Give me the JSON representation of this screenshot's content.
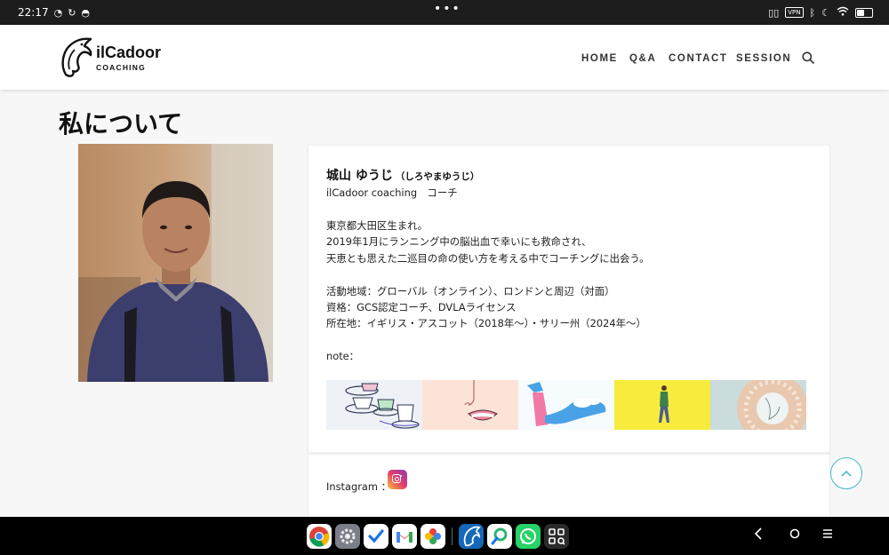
{
  "status": {
    "time": "22:17",
    "center_dots": "•••",
    "vpn": "VPN"
  },
  "header": {
    "logo_word": "ilCadoor",
    "logo_sub": "COACHING",
    "nav": [
      "HOME",
      "Q&A",
      "CONTACT",
      "SESSION"
    ]
  },
  "page": {
    "title": "私について"
  },
  "profile": {
    "name": "城山 ゆうじ",
    "name_kana": "（しろやまゆうじ）",
    "role": "ilCadoor coaching　コーチ",
    "bio": [
      "東京都大田区生まれ。",
      "2019年1月にランニング中の脳出血で幸いにも救命され、",
      "天恵とも思えた二巡目の命の使い方を考える中でコーチングに出会う。"
    ],
    "details": [
      "活動地域：グローバル（オンライン）、ロンドンと周辺（対面）",
      "資格：GCS認定コーチ、DVLAライセンス",
      "所在地：イギリス・アスコット（2018年〜）・サリー州（2024年〜）"
    ],
    "note_label": "note：",
    "instagram_label": "Instagram ："
  },
  "colors": {
    "accent": "#3fb7c8",
    "header_bg": "#ffffff",
    "page_bg": "#f7f7f7"
  },
  "icons": {
    "search": "search-icon",
    "scroll_top": "chevron-up-icon",
    "instagram": "instagram-icon"
  },
  "status_battery_level": 0.5
}
